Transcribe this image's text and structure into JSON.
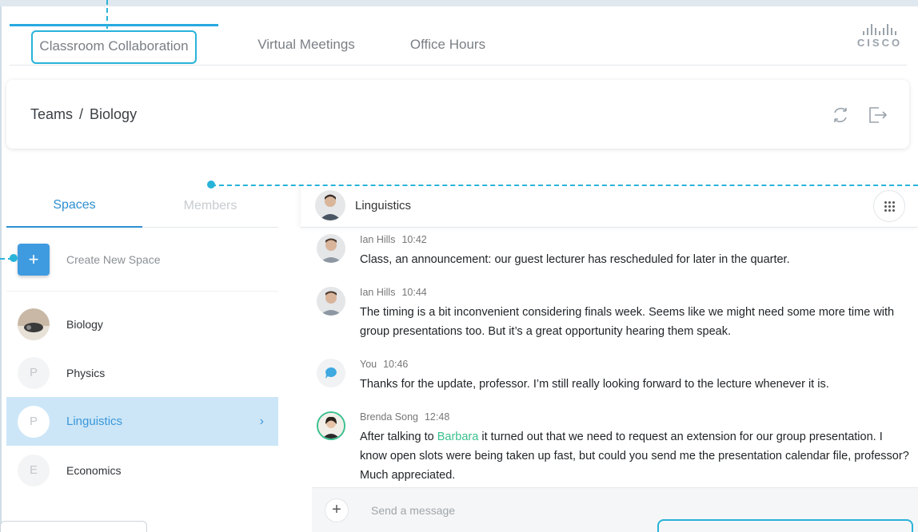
{
  "tabs": [
    {
      "label": "Classroom Collaboration",
      "active": true
    },
    {
      "label": "Virtual Meetings",
      "active": false
    },
    {
      "label": "Office Hours",
      "active": false
    }
  ],
  "brand": {
    "name": "CISCO"
  },
  "breadcrumb": {
    "parent": "Teams",
    "separator": "/",
    "current": "Biology"
  },
  "header_icons": [
    "sync-icon",
    "exit-icon"
  ],
  "left_panel": {
    "tabs": [
      {
        "label": "Spaces",
        "active": true
      },
      {
        "label": "Members",
        "active": false
      }
    ],
    "create_label": "Create New Space",
    "spaces": [
      {
        "name": "Biology",
        "initial": "",
        "selected": false
      },
      {
        "name": "Physics",
        "initial": "P",
        "selected": false
      },
      {
        "name": "Linguistics",
        "initial": "P",
        "selected": true
      },
      {
        "name": "Economics",
        "initial": "E",
        "selected": false
      }
    ]
  },
  "chat": {
    "title": "Linguistics",
    "messages": [
      {
        "author": "Ian Hills",
        "time": "10:42",
        "text": "Class, an announcement: our guest lecturer has rescheduled for later in the quarter."
      },
      {
        "author": "Ian Hills",
        "time": "10:44",
        "text": "The timing is a bit inconvenient considering finals week. Seems like we might need some more time with group presentations too. But it’s a great opportunity hearing them speak."
      },
      {
        "author": "You",
        "time": "10:46",
        "text": "Thanks for the update, professor. I’m still really looking forward to the lecture whenever it is."
      },
      {
        "author": "Brenda Song",
        "time": "12:48",
        "text_before": "After talking to ",
        "mention": "Barbara",
        "text_after": " it turned out that we need to request an extension for our group presentation. I know open slots were being taken up fast, but could you send me the presentation calendar file, professor? Much appreciated."
      }
    ],
    "composer_placeholder": "Send a message"
  },
  "colors": {
    "accent": "#27a9e1",
    "primary_button": "#3f9be0",
    "selected_row": "#cce6f7",
    "mention": "#3bbf8f",
    "annotation": "#29b3d9"
  }
}
